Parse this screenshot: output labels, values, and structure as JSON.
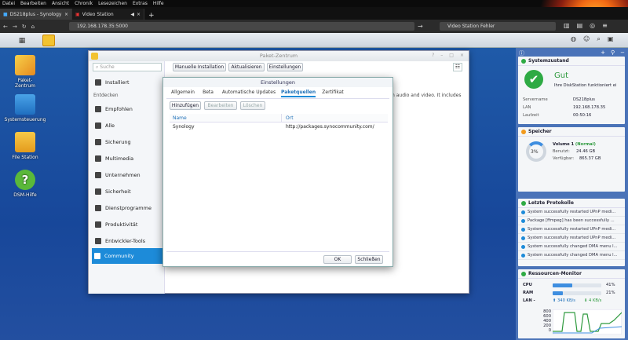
{
  "browser": {
    "menu": [
      "Datei",
      "Bearbeiten",
      "Ansicht",
      "Chronik",
      "Lesezeichen",
      "Extras",
      "Hilfe"
    ],
    "tabs": [
      {
        "title": "DS218plus - Synology DiskStati",
        "active": true
      },
      {
        "title": "Video Station",
        "active": false
      }
    ],
    "new_tab": "+",
    "url": "192.168.178.35:5000",
    "search_value": "Video Station Fehler"
  },
  "desktop": {
    "icons": [
      {
        "label": "Paket-\nZentrum"
      },
      {
        "label": "Systemsteuerung"
      },
      {
        "label": "File Station"
      },
      {
        "label": "DSM-Hilfe"
      }
    ]
  },
  "pkg": {
    "title": "Paket-Zentrum",
    "search_placeholder": "Suche",
    "installed": "Installiert",
    "discover": "Entdecken",
    "sidebar": [
      "Empfohlen",
      "Alle",
      "Sicherung",
      "Multimedia",
      "Unternehmen",
      "Sicherheit",
      "Dienstprogramme",
      "Produktivität",
      "Entwickler-Tools",
      "Community"
    ],
    "toolbar": {
      "manual": "Manuelle Installation",
      "refresh": "Aktualisieren",
      "settings": "Einstellungen"
    },
    "bg_text": "m audio and video. It includes"
  },
  "dialog": {
    "title": "Einstellungen",
    "tabs": [
      "Allgemein",
      "Beta",
      "Automatische Updates",
      "Paketquellen",
      "Zertifikat"
    ],
    "selected_tab": "Paketquellen",
    "actions": {
      "add": "Hinzufügen",
      "edit": "Bearbeiten",
      "delete": "Löschen"
    },
    "columns": {
      "name": "Name",
      "location": "Ort"
    },
    "rows": [
      {
        "name": "Synology",
        "location": "http://packages.synocommunity.com/"
      }
    ],
    "ok": "OK",
    "close": "Schließen"
  },
  "widgets": {
    "health": {
      "title": "Systemzustand",
      "status": "Gut",
      "message": "Ihre DiskStation funktioniert ei",
      "server_label": "Servername",
      "server_value": "DS218plus",
      "lan_label": "LAN",
      "lan_value": "192.168.178.35",
      "uptime_label": "Laufzeit",
      "uptime_value": "00:50:16"
    },
    "storage": {
      "title": "Speicher",
      "percent": "3%",
      "volume": "Volume 1",
      "volume_status": "(Normal)",
      "used_label": "Benutzt:",
      "used_value": "24.46 GB",
      "free_label": "Verfügbar:",
      "free_value": "865.37 GB"
    },
    "logs": {
      "title": "Letzte Protokolle",
      "rows": [
        "System successfully restarted UPnP medi...",
        "Package [ffmpeg] has been successfully ...",
        "System successfully restarted UPnP medi...",
        "System successfully restarted UPnP medi...",
        "System successfully changed DMA menu l...",
        "System successfully changed DMA menu l..."
      ]
    },
    "monitor": {
      "title": "Ressourcen-Monitor",
      "cpu_label": "CPU",
      "cpu_value": "41%",
      "cpu_level": 0.41,
      "ram_label": "RAM",
      "ram_value": "21%",
      "ram_level": 0.21,
      "lan_label": "LAN -",
      "lan_up": "340 KB/s",
      "lan_down": "4 KB/s",
      "yticks": [
        "800",
        "600",
        "400",
        "200",
        "0"
      ]
    }
  },
  "colors": {
    "accent": "#1d8bd9",
    "ok": "#2eaa44",
    "desktop": "#1f5aa8"
  }
}
